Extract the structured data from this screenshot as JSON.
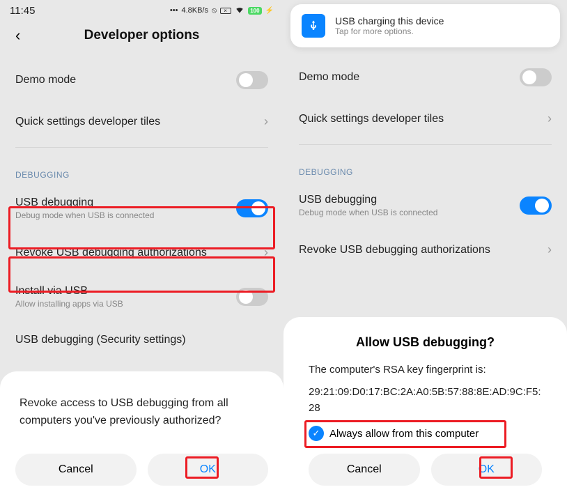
{
  "left": {
    "status": {
      "time": "11:45",
      "speed": "4.8KB/s"
    },
    "header": {
      "title": "Developer options"
    },
    "rows": {
      "demo": "Demo mode",
      "quick": "Quick settings developer tiles",
      "section": "DEBUGGING",
      "usb_title": "USB debugging",
      "usb_sub": "Debug mode when USB is connected",
      "revoke": "Revoke USB debugging authorizations",
      "install_title": "Install via USB",
      "install_sub": "Allow installing apps via USB",
      "security": "USB debugging (Security settings)"
    },
    "sheet": {
      "text": "Revoke access to USB debugging from all computers you've previously authorized?",
      "cancel": "Cancel",
      "ok": "OK"
    }
  },
  "right": {
    "notif": {
      "title": "USB charging this device",
      "sub": "Tap for more options."
    },
    "header": {
      "title": "Developer options"
    },
    "rows": {
      "demo": "Demo mode",
      "quick": "Quick settings developer tiles",
      "section": "DEBUGGING",
      "usb_title": "USB debugging",
      "usb_sub": "Debug mode when USB is connected",
      "revoke": "Revoke USB debugging authorizations"
    },
    "sheet": {
      "title": "Allow USB debugging?",
      "text1": "The computer's RSA key fingerprint is:",
      "text2": "29:21:09:D0:17:BC:2A:A0:5B:57:88:8E:AD:9C:F5:28",
      "checkbox": "Always allow from this computer",
      "cancel": "Cancel",
      "ok": "OK"
    }
  }
}
